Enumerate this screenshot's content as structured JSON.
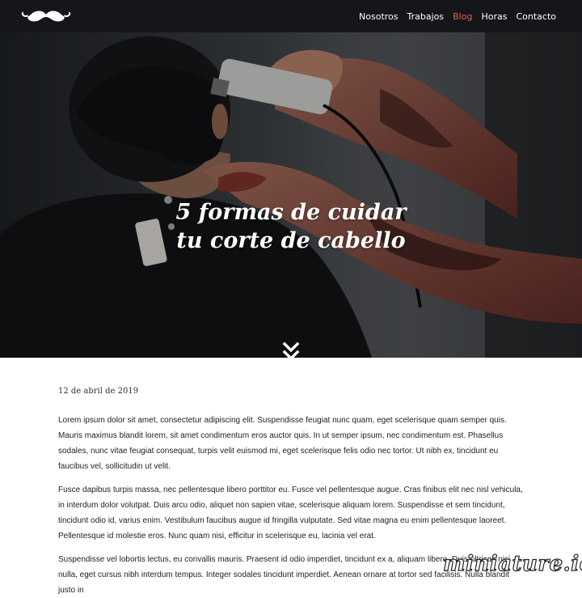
{
  "header": {
    "logo_name": "mustache-icon",
    "nav": [
      {
        "label": "Nosotros"
      },
      {
        "label": "Trabajos"
      },
      {
        "label": "Blog",
        "active": true
      },
      {
        "label": "Horas"
      },
      {
        "label": "Contacto"
      }
    ]
  },
  "hero": {
    "title_line1": "5 formas de cuidar",
    "title_line2": "tu corte de cabello",
    "scroll_icon": "double-chevron-down-icon"
  },
  "article": {
    "date": "12 de abril de 2019",
    "paragraphs": [
      "Lorem ipsum dolor sit amet, consectetur adipiscing elit. Suspendisse feugiat nunc quam, eget scelerisque quam semper quis. Mauris maximus blandit lorem, sit amet condimentum eros auctor quis. In ut semper ipsum, nec condimentum est. Phasellus sodales, nunc vitae feugiat consequat, turpis velit euismod mi, eget scelerisque felis odio nec tortor. Ut nibh ex, tincidunt eu faucibus vel, sollicitudin ut velit.",
      "Fusce dapibus turpis massa, nec pellentesque libero porttitor eu. Fusce vel pellentesque augue. Cras finibus elit nec nisl vehicula, in interdum dolor volutpat. Duis arcu odio, aliquet non sapien vitae, scelerisque aliquam lorem. Suspendisse et sem tincidunt, tincidunt odio id, varius enim. Vestibulum faucibus augue id fringilla vulputate. Sed vitae magna eu enim pellentesque laoreet. Pellentesque id molestie eros. Nunc quam nisi, efficitur in scelerisque eu, lacinia vel erat.",
      "Suspendisse vel lobortis lectus, eu convallis mauris. Praesent id odio imperdiet, tincidunt ex a, aliquam libero. Duis ultrices nisi nulla, eget cursus nibh interdum tempus. Integer sodales tincidunt imperdiet. Aenean ornare at tortor sed facilisis. Nulla blandit justo in"
    ]
  },
  "watermark": "miniature.io",
  "colors": {
    "navbar": "#15161a",
    "accent": "#e2604c",
    "text": "#222222"
  }
}
